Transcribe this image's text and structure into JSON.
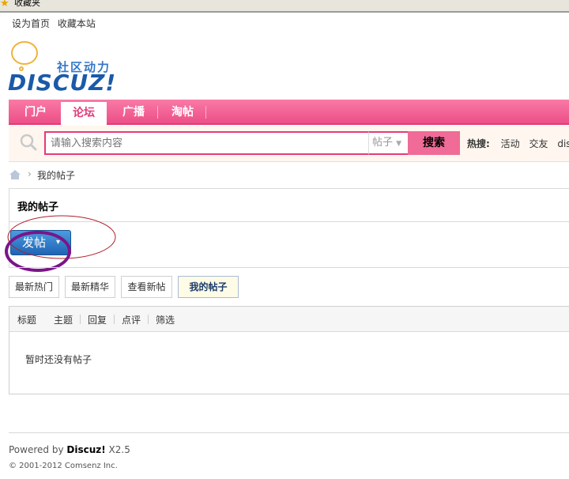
{
  "favorites_bar": {
    "icon": "star-icon",
    "label": "收藏夹"
  },
  "toplinks": {
    "set_home": "设为首页",
    "bookmark": "收藏本站"
  },
  "logo": {
    "subtitle": "社区动力",
    "brand": "DISCUZ!"
  },
  "nav": {
    "items": [
      {
        "label": "门户",
        "active": false
      },
      {
        "label": "论坛",
        "active": true
      },
      {
        "label": "广播",
        "active": false
      },
      {
        "label": "淘帖",
        "active": false
      }
    ],
    "color": "#ec4f86"
  },
  "search": {
    "placeholder": "请输入搜索内容",
    "select_value": "帖子",
    "button": "搜索",
    "hot_label": "热搜:",
    "hot_items": [
      "活动",
      "交友",
      "dis"
    ]
  },
  "breadcrumb": {
    "current": "我的帖子"
  },
  "panel": {
    "title": "我的帖子",
    "post_button": "发帖",
    "post_caret": "▾"
  },
  "tabs": [
    {
      "label": "最新热门",
      "active": false
    },
    {
      "label": "最新精华",
      "active": false
    },
    {
      "label": "查看新帖",
      "active": false
    },
    {
      "label": "我的帖子",
      "active": true
    }
  ],
  "filters": [
    "标题",
    "主题",
    "回复",
    "点评",
    "筛选"
  ],
  "empty_message": "暂时还没有帖子",
  "footer": {
    "powered_prefix": "Powered by ",
    "powered_brand": "Discuz!",
    "powered_version": " X2.5",
    "copyright": "© 2001-2012 Comsenz Inc."
  }
}
